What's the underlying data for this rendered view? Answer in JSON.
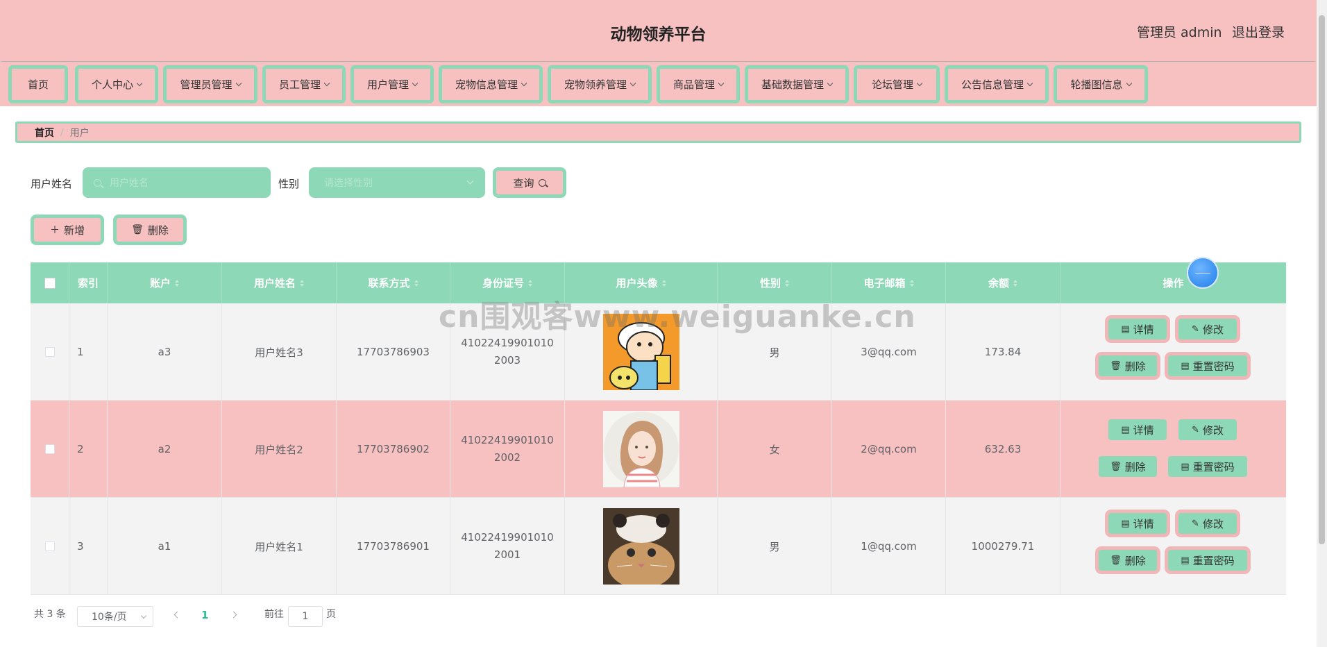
{
  "header": {
    "title": "动物领养平台",
    "admin_label": "管理员 admin",
    "logout_label": "退出登录"
  },
  "nav": [
    {
      "label": "首页",
      "dropdown": false
    },
    {
      "label": "个人中心",
      "dropdown": true
    },
    {
      "label": "管理员管理",
      "dropdown": true
    },
    {
      "label": "员工管理",
      "dropdown": true
    },
    {
      "label": "用户管理",
      "dropdown": true
    },
    {
      "label": "宠物信息管理",
      "dropdown": true
    },
    {
      "label": "宠物领养管理",
      "dropdown": true
    },
    {
      "label": "商品管理",
      "dropdown": true
    },
    {
      "label": "基础数据管理",
      "dropdown": true
    },
    {
      "label": "论坛管理",
      "dropdown": true
    },
    {
      "label": "公告信息管理",
      "dropdown": true
    },
    {
      "label": "轮播图信息",
      "dropdown": true
    }
  ],
  "breadcrumb": {
    "home": "首页",
    "separator": "/",
    "current": "用户"
  },
  "search": {
    "name_label": "用户姓名",
    "name_placeholder": "用户姓名",
    "gender_label": "性别",
    "gender_placeholder": "请选择性别",
    "query_button": "查询"
  },
  "actions": {
    "add_button": "新增",
    "delete_button": "删除"
  },
  "table": {
    "columns": [
      "索引",
      "账户",
      "用户姓名",
      "联系方式",
      "身份证号",
      "用户头像",
      "性别",
      "电子邮箱",
      "余额",
      "操作"
    ],
    "rows": [
      {
        "index": "1",
        "account": "a3",
        "name": "用户姓名3",
        "phone": "17703786903",
        "id_card": "410224199010102003",
        "avatar": "cartoon-boy-avatar",
        "gender": "男",
        "email": "3@qq.com",
        "balance": "173.84"
      },
      {
        "index": "2",
        "account": "a2",
        "name": "用户姓名2",
        "phone": "17703786902",
        "id_card": "410224199010102002",
        "avatar": "girl-illustration-avatar",
        "gender": "女",
        "email": "2@qq.com",
        "balance": "632.63"
      },
      {
        "index": "3",
        "account": "a1",
        "name": "用户姓名1",
        "phone": "17703786901",
        "id_card": "410224199010102001",
        "avatar": "cat-photo-avatar",
        "gender": "男",
        "email": "1@qq.com",
        "balance": "1000279.71"
      }
    ],
    "op_labels": {
      "detail": "详情",
      "edit": "修改",
      "delete": "删除",
      "reset": "重置密码"
    }
  },
  "pagination": {
    "total": "共 3 条",
    "page_size": "10条/页",
    "current_page": "1",
    "goto_prefix": "前往",
    "goto_value": "1",
    "goto_suffix": "页"
  },
  "watermark": "cn围观客www.weiguanke.cn",
  "colors": {
    "pink": "#f7c1c2",
    "green": "#8dd8b6",
    "ring_pink": "#f0b6b8"
  }
}
